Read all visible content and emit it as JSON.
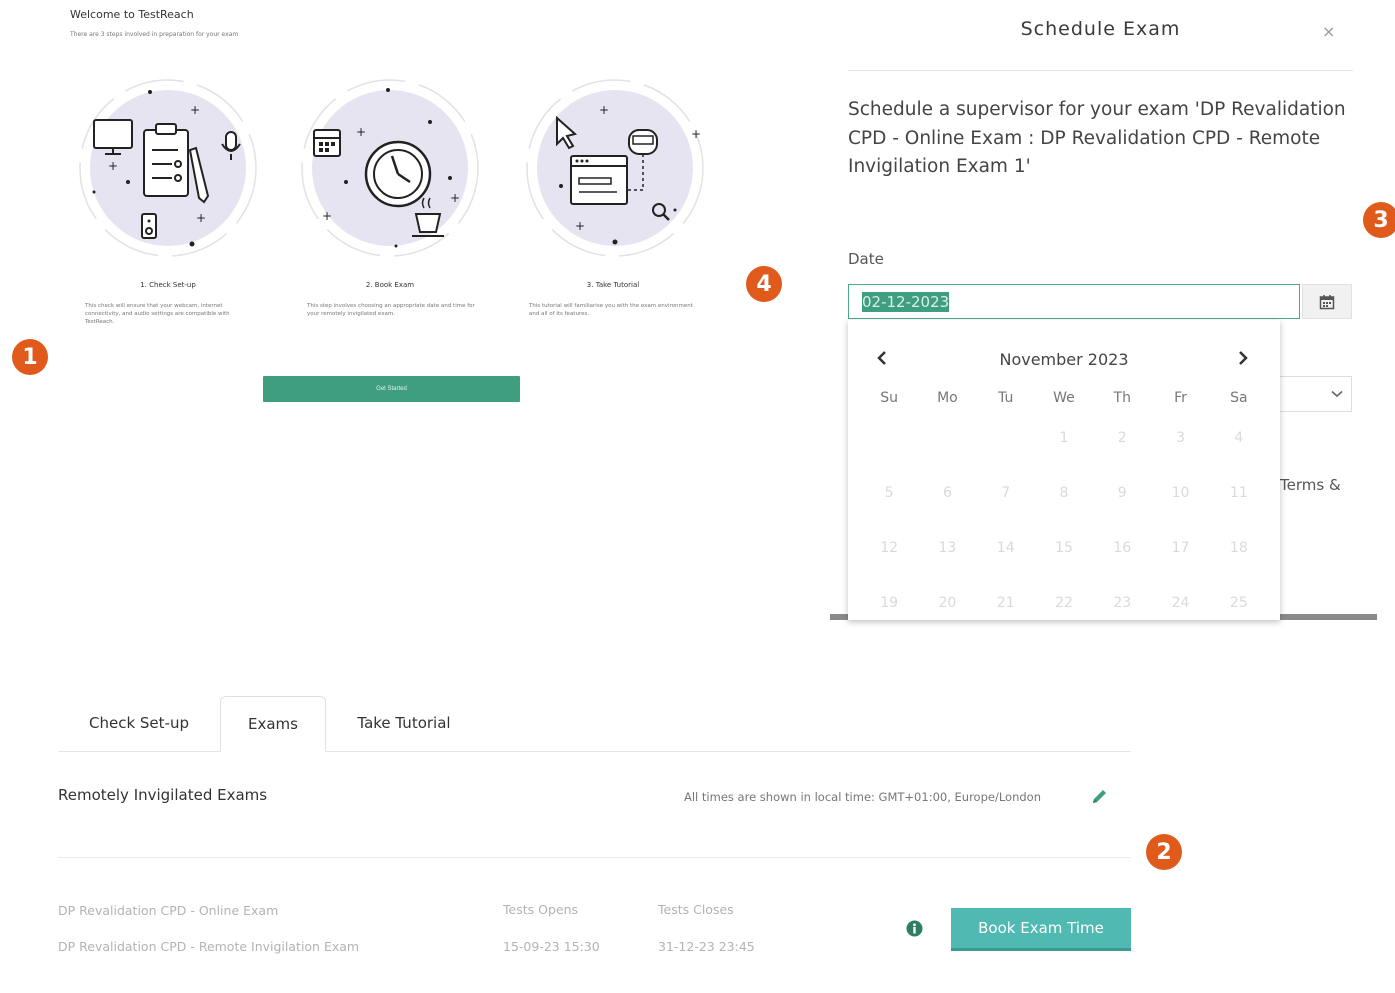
{
  "welcome": {
    "title": "Welcome to TestReach",
    "subtitle": "There are 3 steps involved in preparation for your exam",
    "steps": [
      {
        "title": "1. Check Set-up",
        "desc": "This check will ensure that your webcam, internet connectivity, and audio settings are compatible with TestReach."
      },
      {
        "title": "2. Book Exam",
        "desc": "This step involves choosing an appropriate date and time for your remotely invigilated exam."
      },
      {
        "title": "3. Take Tutorial",
        "desc": "This tutorial will familiarise you with the exam environment and all of its features."
      }
    ],
    "get_started": "Get Started"
  },
  "markers": {
    "m1": "1",
    "m2": "2",
    "m3": "3",
    "m4": "4"
  },
  "dialog": {
    "title": "Schedule Exam",
    "close": "×",
    "message": "Schedule a supervisor for your exam 'DP Revalidation CPD - Online Exam : DP Revalidation CPD - Remote Invigilation Exam 1'",
    "date_label": "Date",
    "date_value": "02-12-2023",
    "terms_partial": "Terms &"
  },
  "calendar": {
    "month": "November 2023",
    "weekdays": [
      "Su",
      "Mo",
      "Tu",
      "We",
      "Th",
      "Fr",
      "Sa"
    ],
    "rows": [
      [
        "",
        "",
        "",
        "1",
        "2",
        "3",
        "4"
      ],
      [
        "5",
        "6",
        "7",
        "8",
        "9",
        "10",
        "11"
      ],
      [
        "12",
        "13",
        "14",
        "15",
        "16",
        "17",
        "18"
      ],
      [
        "19",
        "20",
        "21",
        "22",
        "23",
        "24",
        "25"
      ]
    ]
  },
  "tabs": [
    {
      "label": "Check Set-up"
    },
    {
      "label": "Exams"
    },
    {
      "label": "Take Tutorial"
    }
  ],
  "exams": {
    "section_title": "Remotely Invigilated Exams",
    "timezone_note": "All times are shown in local time: GMT+01:00, Europe/London",
    "exam_name_1": "DP Revalidation CPD - Online Exam",
    "exam_name_2": "DP Revalidation CPD - Remote Invigilation Exam",
    "opens_label": "Tests Opens",
    "opens_value": "15-09-23 15:30",
    "closes_label": "Tests Closes",
    "closes_value": "31-12-23 23:45",
    "book_button": "Book Exam Time"
  },
  "colors": {
    "accent": "#3f9d80",
    "marker": "#e05a1c",
    "book": "#4fb9b2",
    "illustration_bg": "#e7e4f1"
  }
}
